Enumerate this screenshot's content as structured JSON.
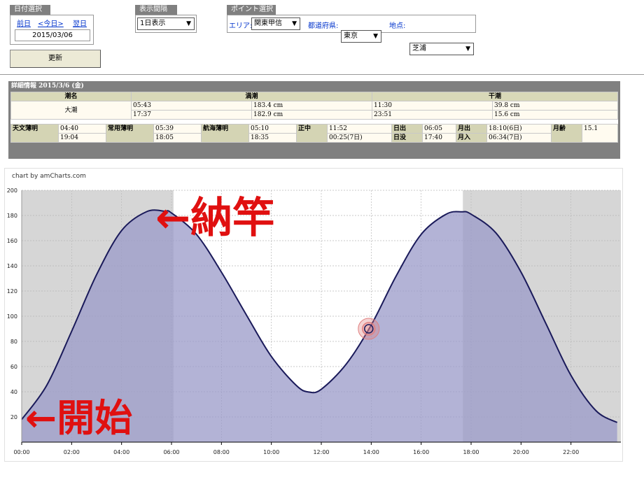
{
  "date_panel": {
    "title": "日付選択",
    "prev": "前日",
    "today": "<今日>",
    "next": "翌日",
    "date": "2015/03/06"
  },
  "interval_panel": {
    "title": "表示間隔",
    "selected": "1日表示"
  },
  "point_panel": {
    "title": "ポイント選択",
    "area_label": "エリア:",
    "area_value": "関東甲信",
    "pref_label": "都道府県:",
    "pref_value": "東京",
    "place_label": "地点:",
    "place_value": "芝浦"
  },
  "update_button": "更新",
  "details": {
    "title": "詳細情報  2015/3/6 (金)",
    "tide_name_header": "潮名",
    "high_header": "満潮",
    "low_header": "干潮",
    "tide_name": "大潮",
    "high": [
      {
        "time": "05:43",
        "level": "183.4 cm"
      },
      {
        "time": "17:37",
        "level": "182.9 cm"
      }
    ],
    "low": [
      {
        "time": "11:30",
        "level": "39.8 cm"
      },
      {
        "time": "23:51",
        "level": "15.6 cm"
      }
    ],
    "twilight": {
      "astro_label": "天文薄明",
      "astro_1": "04:40",
      "astro_2": "19:04",
      "civil_label": "常用薄明",
      "civil_1": "05:39",
      "civil_2": "18:05",
      "nautical_label": "航海薄明",
      "nautical_1": "05:10",
      "nautical_2": "18:35",
      "noon_label": "正中",
      "noon_1": "11:52",
      "noon_2": "00:25(7日)",
      "sunrise_label": "日出",
      "sunrise": "06:05",
      "sunset_label": "日没",
      "sunset": "17:40",
      "moonrise_label": "月出",
      "moonrise": "18:10(6日)",
      "moonset_label": "月入",
      "moonset": "06:34(7日)",
      "moonage_label": "月齢",
      "moonage": "15.1"
    }
  },
  "chart_credit": "chart by amCharts.com",
  "annotations": {
    "top": "←納竿",
    "bottom": "←開始"
  },
  "colors": {
    "fill": "#9a9ac8",
    "line": "#1a1a5a",
    "night": "#d6d6d6",
    "marker": "#e08080",
    "annotation": "#e01010"
  },
  "chart_data": {
    "type": "area",
    "x_unit": "hour",
    "x": [
      0,
      1,
      2,
      3,
      4,
      5,
      5.72,
      6,
      7,
      8,
      9,
      10,
      11,
      11.5,
      12,
      13,
      14,
      15,
      16,
      17,
      17.62,
      18,
      19,
      20,
      21,
      22,
      23,
      23.85
    ],
    "y": [
      18,
      45,
      88,
      133,
      168,
      183,
      183.4,
      182,
      165,
      135,
      101,
      68,
      45,
      39.8,
      42,
      62,
      93,
      132,
      165,
      181,
      182.9,
      181,
      166,
      135,
      94,
      53,
      25,
      15.6
    ],
    "ylim": [
      0,
      200
    ],
    "yticks": [
      20,
      40,
      60,
      80,
      100,
      120,
      140,
      160,
      180,
      200
    ],
    "xlim": [
      0,
      24
    ],
    "xtick_labels": [
      "00:00",
      "02:00",
      "04:00",
      "06:00",
      "08:00",
      "10:00",
      "12:00",
      "14:00",
      "16:00",
      "18:00",
      "20:00",
      "22:00"
    ],
    "night_bands": [
      [
        0,
        6.08
      ],
      [
        17.67,
        24
      ]
    ],
    "marker": {
      "x": 13.9,
      "y": 90
    },
    "grid": true
  }
}
